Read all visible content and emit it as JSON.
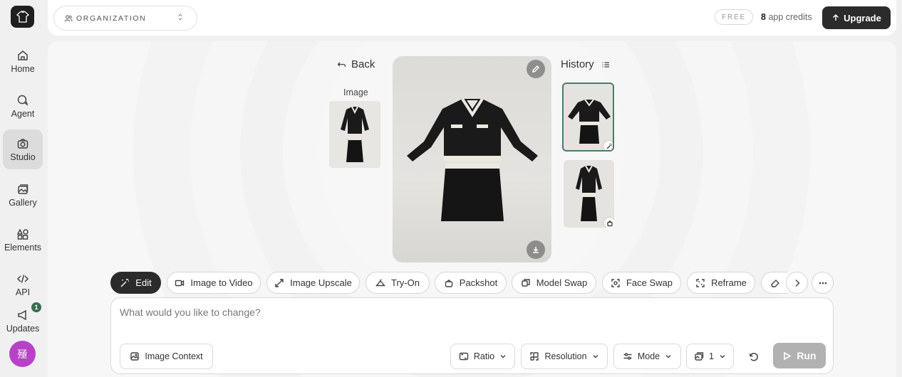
{
  "sidebar": {
    "items": [
      {
        "label": "Home",
        "icon": "home-icon"
      },
      {
        "label": "Agent",
        "icon": "chat-icon"
      },
      {
        "label": "Studio",
        "icon": "camera-icon",
        "active": true
      },
      {
        "label": "Gallery",
        "icon": "gallery-icon"
      },
      {
        "label": "Elements",
        "icon": "shapes-icon"
      },
      {
        "label": "API",
        "icon": "code-icon"
      },
      {
        "label": "Updates",
        "icon": "megaphone-icon",
        "badge": "1"
      }
    ],
    "avatar_text": "殛"
  },
  "topbar": {
    "org_label": "ORGANIZATION",
    "plan_badge": "FREE",
    "credits_count": "8",
    "credits_suffix": "app credits",
    "upgrade_label": "Upgrade"
  },
  "canvas": {
    "back_label": "Back",
    "image_label": "Image",
    "history_label": "History"
  },
  "tools": [
    {
      "label": "Edit",
      "icon": "magic-wand-icon",
      "active": true
    },
    {
      "label": "Image to Video",
      "icon": "video-icon"
    },
    {
      "label": "Image Upscale",
      "icon": "expand-icon"
    },
    {
      "label": "Try-On",
      "icon": "hanger-icon"
    },
    {
      "label": "Packshot",
      "icon": "bag-icon"
    },
    {
      "label": "Model Swap",
      "icon": "swap-icon"
    },
    {
      "label": "Face Swap",
      "icon": "face-scan-icon"
    },
    {
      "label": "Reframe",
      "icon": "reframe-icon"
    }
  ],
  "prompt": {
    "placeholder": "What would you like to change?",
    "image_context_label": "Image Context",
    "ratio_label": "Ratio",
    "resolution_label": "Resolution",
    "mode_label": "Mode",
    "count_value": "1",
    "run_label": "Run"
  },
  "colors": {
    "accent_dark": "#2b2b2b",
    "avatar": "#b643c7",
    "selection_border": "#4f7a6e",
    "badge": "#3b6b52"
  }
}
